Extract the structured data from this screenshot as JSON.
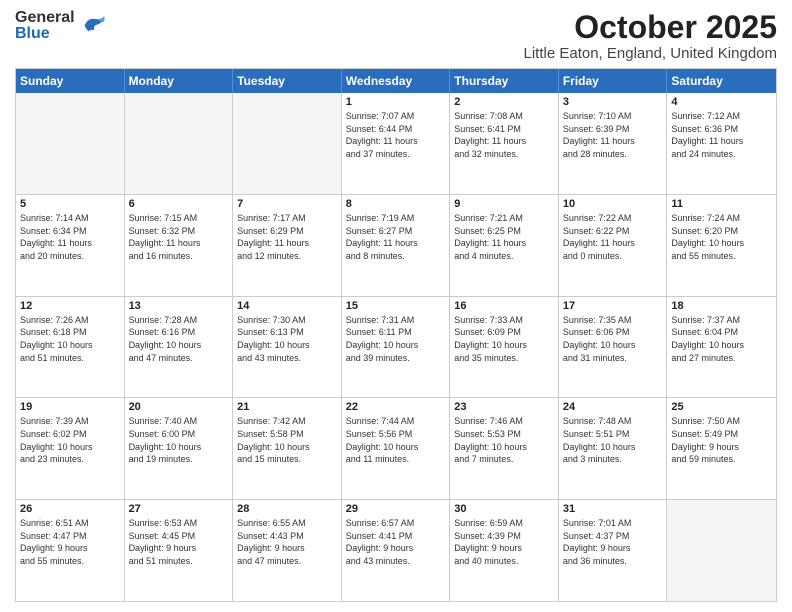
{
  "header": {
    "logo_general": "General",
    "logo_blue": "Blue",
    "title": "October 2025",
    "location": "Little Eaton, England, United Kingdom"
  },
  "days_of_week": [
    "Sunday",
    "Monday",
    "Tuesday",
    "Wednesday",
    "Thursday",
    "Friday",
    "Saturday"
  ],
  "weeks": [
    [
      {
        "day": "",
        "info": [],
        "empty": true
      },
      {
        "day": "",
        "info": [],
        "empty": true
      },
      {
        "day": "",
        "info": [],
        "empty": true
      },
      {
        "day": "1",
        "info": [
          "Sunrise: 7:07 AM",
          "Sunset: 6:44 PM",
          "Daylight: 11 hours",
          "and 37 minutes."
        ],
        "empty": false
      },
      {
        "day": "2",
        "info": [
          "Sunrise: 7:08 AM",
          "Sunset: 6:41 PM",
          "Daylight: 11 hours",
          "and 32 minutes."
        ],
        "empty": false
      },
      {
        "day": "3",
        "info": [
          "Sunrise: 7:10 AM",
          "Sunset: 6:39 PM",
          "Daylight: 11 hours",
          "and 28 minutes."
        ],
        "empty": false
      },
      {
        "day": "4",
        "info": [
          "Sunrise: 7:12 AM",
          "Sunset: 6:36 PM",
          "Daylight: 11 hours",
          "and 24 minutes."
        ],
        "empty": false
      }
    ],
    [
      {
        "day": "5",
        "info": [
          "Sunrise: 7:14 AM",
          "Sunset: 6:34 PM",
          "Daylight: 11 hours",
          "and 20 minutes."
        ],
        "empty": false
      },
      {
        "day": "6",
        "info": [
          "Sunrise: 7:15 AM",
          "Sunset: 6:32 PM",
          "Daylight: 11 hours",
          "and 16 minutes."
        ],
        "empty": false
      },
      {
        "day": "7",
        "info": [
          "Sunrise: 7:17 AM",
          "Sunset: 6:29 PM",
          "Daylight: 11 hours",
          "and 12 minutes."
        ],
        "empty": false
      },
      {
        "day": "8",
        "info": [
          "Sunrise: 7:19 AM",
          "Sunset: 6:27 PM",
          "Daylight: 11 hours",
          "and 8 minutes."
        ],
        "empty": false
      },
      {
        "day": "9",
        "info": [
          "Sunrise: 7:21 AM",
          "Sunset: 6:25 PM",
          "Daylight: 11 hours",
          "and 4 minutes."
        ],
        "empty": false
      },
      {
        "day": "10",
        "info": [
          "Sunrise: 7:22 AM",
          "Sunset: 6:22 PM",
          "Daylight: 11 hours",
          "and 0 minutes."
        ],
        "empty": false
      },
      {
        "day": "11",
        "info": [
          "Sunrise: 7:24 AM",
          "Sunset: 6:20 PM",
          "Daylight: 10 hours",
          "and 55 minutes."
        ],
        "empty": false
      }
    ],
    [
      {
        "day": "12",
        "info": [
          "Sunrise: 7:26 AM",
          "Sunset: 6:18 PM",
          "Daylight: 10 hours",
          "and 51 minutes."
        ],
        "empty": false
      },
      {
        "day": "13",
        "info": [
          "Sunrise: 7:28 AM",
          "Sunset: 6:16 PM",
          "Daylight: 10 hours",
          "and 47 minutes."
        ],
        "empty": false
      },
      {
        "day": "14",
        "info": [
          "Sunrise: 7:30 AM",
          "Sunset: 6:13 PM",
          "Daylight: 10 hours",
          "and 43 minutes."
        ],
        "empty": false
      },
      {
        "day": "15",
        "info": [
          "Sunrise: 7:31 AM",
          "Sunset: 6:11 PM",
          "Daylight: 10 hours",
          "and 39 minutes."
        ],
        "empty": false
      },
      {
        "day": "16",
        "info": [
          "Sunrise: 7:33 AM",
          "Sunset: 6:09 PM",
          "Daylight: 10 hours",
          "and 35 minutes."
        ],
        "empty": false
      },
      {
        "day": "17",
        "info": [
          "Sunrise: 7:35 AM",
          "Sunset: 6:06 PM",
          "Daylight: 10 hours",
          "and 31 minutes."
        ],
        "empty": false
      },
      {
        "day": "18",
        "info": [
          "Sunrise: 7:37 AM",
          "Sunset: 6:04 PM",
          "Daylight: 10 hours",
          "and 27 minutes."
        ],
        "empty": false
      }
    ],
    [
      {
        "day": "19",
        "info": [
          "Sunrise: 7:39 AM",
          "Sunset: 6:02 PM",
          "Daylight: 10 hours",
          "and 23 minutes."
        ],
        "empty": false
      },
      {
        "day": "20",
        "info": [
          "Sunrise: 7:40 AM",
          "Sunset: 6:00 PM",
          "Daylight: 10 hours",
          "and 19 minutes."
        ],
        "empty": false
      },
      {
        "day": "21",
        "info": [
          "Sunrise: 7:42 AM",
          "Sunset: 5:58 PM",
          "Daylight: 10 hours",
          "and 15 minutes."
        ],
        "empty": false
      },
      {
        "day": "22",
        "info": [
          "Sunrise: 7:44 AM",
          "Sunset: 5:56 PM",
          "Daylight: 10 hours",
          "and 11 minutes."
        ],
        "empty": false
      },
      {
        "day": "23",
        "info": [
          "Sunrise: 7:46 AM",
          "Sunset: 5:53 PM",
          "Daylight: 10 hours",
          "and 7 minutes."
        ],
        "empty": false
      },
      {
        "day": "24",
        "info": [
          "Sunrise: 7:48 AM",
          "Sunset: 5:51 PM",
          "Daylight: 10 hours",
          "and 3 minutes."
        ],
        "empty": false
      },
      {
        "day": "25",
        "info": [
          "Sunrise: 7:50 AM",
          "Sunset: 5:49 PM",
          "Daylight: 9 hours",
          "and 59 minutes."
        ],
        "empty": false
      }
    ],
    [
      {
        "day": "26",
        "info": [
          "Sunrise: 6:51 AM",
          "Sunset: 4:47 PM",
          "Daylight: 9 hours",
          "and 55 minutes."
        ],
        "empty": false
      },
      {
        "day": "27",
        "info": [
          "Sunrise: 6:53 AM",
          "Sunset: 4:45 PM",
          "Daylight: 9 hours",
          "and 51 minutes."
        ],
        "empty": false
      },
      {
        "day": "28",
        "info": [
          "Sunrise: 6:55 AM",
          "Sunset: 4:43 PM",
          "Daylight: 9 hours",
          "and 47 minutes."
        ],
        "empty": false
      },
      {
        "day": "29",
        "info": [
          "Sunrise: 6:57 AM",
          "Sunset: 4:41 PM",
          "Daylight: 9 hours",
          "and 43 minutes."
        ],
        "empty": false
      },
      {
        "day": "30",
        "info": [
          "Sunrise: 6:59 AM",
          "Sunset: 4:39 PM",
          "Daylight: 9 hours",
          "and 40 minutes."
        ],
        "empty": false
      },
      {
        "day": "31",
        "info": [
          "Sunrise: 7:01 AM",
          "Sunset: 4:37 PM",
          "Daylight: 9 hours",
          "and 36 minutes."
        ],
        "empty": false
      },
      {
        "day": "",
        "info": [],
        "empty": true
      }
    ]
  ]
}
